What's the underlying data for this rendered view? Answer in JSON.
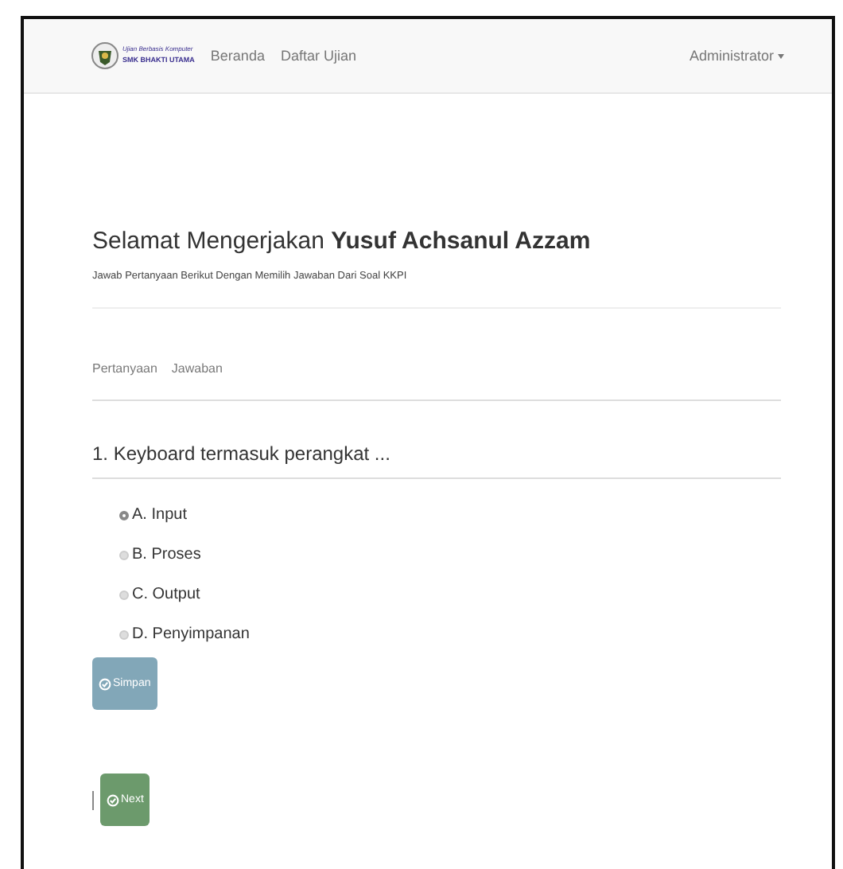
{
  "navbar": {
    "brand": {
      "line_1": "Ujian Berbasis Komputer",
      "line_2": "SMK BHAKTI UTAMA"
    },
    "links": [
      "Beranda",
      "Daftar Ujian"
    ],
    "user_menu": "Administrator"
  },
  "greeting": {
    "text": "Selamat Mengerjakan **Yusuf Achsanul Azzam**"
  },
  "instruction": "Jawab Pertanyaan Berikut Dengan Memilih Jawaban Dari Soal KKPI",
  "tabs": [
    {
      "label": "Pertanyaan",
      "selected": false
    },
    {
      "label": "Jawaban",
      "selected": false
    }
  ],
  "question": "1. Keyboard termasuk perangkat ...",
  "options": [
    {
      "label": "A. Input",
      "selected": true
    },
    {
      "label": "B. Proses",
      "selected": false
    },
    {
      "label": "C. Output",
      "selected": false
    },
    {
      "label": "D. Penyimpanan",
      "selected": false
    }
  ],
  "save_button": "Simpan",
  "next_button": "Next"
}
